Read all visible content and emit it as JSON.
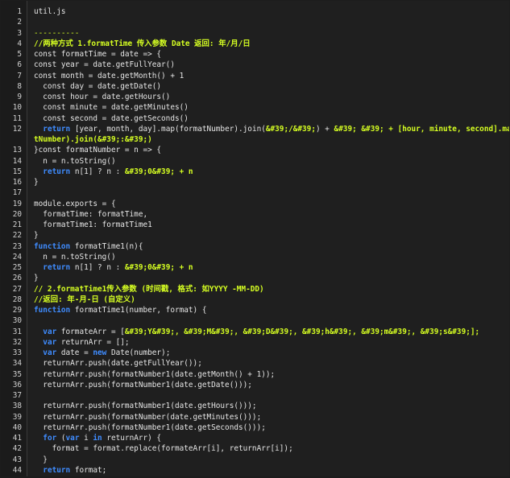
{
  "editor": {
    "lines": [
      {
        "n": null,
        "tokens": [
          {
            "t": "util.js",
            "c": "plain"
          }
        ]
      },
      {
        "n": null,
        "tokens": []
      },
      {
        "n": "3",
        "tokens": [
          {
            "t": "----------",
            "c": "dash"
          }
        ]
      },
      {
        "n": "4",
        "tokens": [
          {
            "t": "//两种方式 1.formatTime 传入参数 Date 返回: 年/月/日",
            "c": "cm"
          }
        ]
      },
      {
        "n": "5",
        "tokens": [
          {
            "t": "const formatTime = date => {",
            "c": "plain"
          }
        ]
      },
      {
        "n": "6",
        "tokens": [
          {
            "t": "const year = date.getFullYear()",
            "c": "plain"
          }
        ]
      },
      {
        "n": "7",
        "tokens": [
          {
            "t": "const month = date.getMonth() + 1",
            "c": "plain"
          }
        ]
      },
      {
        "n": "8",
        "tokens": [
          {
            "t": "  const day = date.getDate()",
            "c": "plain"
          }
        ]
      },
      {
        "n": "9",
        "tokens": [
          {
            "t": "  const hour = date.getHours()",
            "c": "plain"
          }
        ]
      },
      {
        "n": "10",
        "tokens": [
          {
            "t": "  const minute = date.getMinutes()",
            "c": "plain"
          }
        ]
      },
      {
        "n": "11",
        "tokens": [
          {
            "t": "  const second = date.getSeconds()",
            "c": "plain"
          }
        ]
      },
      {
        "n": "12",
        "tokens": [
          {
            "t": "  ",
            "c": "plain"
          },
          {
            "t": "return",
            "c": "kw"
          },
          {
            "t": " [year, month, day].map(formatNumber).join(",
            "c": "plain"
          },
          {
            "t": "&#39;/&#39;",
            "c": "str"
          },
          {
            "t": ") + ",
            "c": "plain"
          },
          {
            "t": "&#39; &#39;",
            "c": "str"
          },
          {
            "t": " + [hour, minute, second].map(forma",
            "c": "str"
          }
        ]
      },
      {
        "n": null,
        "tokens": [
          {
            "t": "tNumber).join(&#39;:&#39;)",
            "c": "str"
          }
        ]
      },
      {
        "n": "13",
        "tokens": [
          {
            "t": "}const formatNumber = n => {",
            "c": "plain"
          }
        ]
      },
      {
        "n": "14",
        "tokens": [
          {
            "t": "  n = n.toString()",
            "c": "plain"
          }
        ]
      },
      {
        "n": "15",
        "tokens": [
          {
            "t": "  ",
            "c": "plain"
          },
          {
            "t": "return",
            "c": "kw"
          },
          {
            "t": " n[1] ? n : ",
            "c": "plain"
          },
          {
            "t": "&#39;0&#39; + n",
            "c": "str"
          }
        ]
      },
      {
        "n": "16",
        "tokens": [
          {
            "t": "}",
            "c": "plain"
          }
        ]
      },
      {
        "n": "17",
        "tokens": []
      },
      {
        "n": "19",
        "tokens": [
          {
            "t": "module.exports = {",
            "c": "plain"
          }
        ]
      },
      {
        "n": "20",
        "tokens": [
          {
            "t": "  formatTime: formatTime,",
            "c": "plain"
          }
        ]
      },
      {
        "n": "21",
        "tokens": [
          {
            "t": "  formatTime1: formatTime1",
            "c": "plain"
          }
        ]
      },
      {
        "n": "22",
        "tokens": [
          {
            "t": "}",
            "c": "plain"
          }
        ]
      },
      {
        "n": "23",
        "tokens": [
          {
            "t": "function",
            "c": "kw"
          },
          {
            "t": " formatTime1(n){",
            "c": "plain"
          }
        ]
      },
      {
        "n": "24",
        "tokens": [
          {
            "t": "  n = n.toString()",
            "c": "plain"
          }
        ]
      },
      {
        "n": "25",
        "tokens": [
          {
            "t": "  ",
            "c": "plain"
          },
          {
            "t": "return",
            "c": "kw"
          },
          {
            "t": " n[1] ? n : ",
            "c": "plain"
          },
          {
            "t": "&#39;0&#39; + n",
            "c": "str"
          }
        ]
      },
      {
        "n": "26",
        "tokens": [
          {
            "t": "}",
            "c": "plain"
          }
        ]
      },
      {
        "n": "27",
        "tokens": [
          {
            "t": "// 2.formatTime1传入参数 (时间戳, 格式: 如YYYY -MM-DD)",
            "c": "cm"
          }
        ]
      },
      {
        "n": "28",
        "tokens": [
          {
            "t": "//返回: 年-月-日 (自定义)",
            "c": "cm"
          }
        ]
      },
      {
        "n": "29",
        "tokens": [
          {
            "t": "function",
            "c": "kw"
          },
          {
            "t": " formatTime1(number, format) {",
            "c": "plain"
          }
        ]
      },
      {
        "n": "30",
        "tokens": []
      },
      {
        "n": "31",
        "tokens": [
          {
            "t": "  ",
            "c": "plain"
          },
          {
            "t": "var",
            "c": "kw"
          },
          {
            "t": " formateArr = [",
            "c": "plain"
          },
          {
            "t": "&#39;Y&#39;, &#39;M&#39;, &#39;D&#39;, &#39;h&#39;, &#39;m&#39;, &#39;s&#39;];",
            "c": "str"
          }
        ]
      },
      {
        "n": "32",
        "tokens": [
          {
            "t": "  ",
            "c": "plain"
          },
          {
            "t": "var",
            "c": "kw"
          },
          {
            "t": " returnArr = [];",
            "c": "plain"
          }
        ]
      },
      {
        "n": "33",
        "tokens": [
          {
            "t": "  ",
            "c": "plain"
          },
          {
            "t": "var",
            "c": "kw"
          },
          {
            "t": " date = ",
            "c": "plain"
          },
          {
            "t": "new",
            "c": "kw"
          },
          {
            "t": " Date(number);",
            "c": "plain"
          }
        ]
      },
      {
        "n": "34",
        "tokens": [
          {
            "t": "  returnArr.push(date.getFullYear());",
            "c": "plain"
          }
        ]
      },
      {
        "n": "35",
        "tokens": [
          {
            "t": "  returnArr.push(formatNumber1(date.getMonth() + 1));",
            "c": "plain"
          }
        ]
      },
      {
        "n": "36",
        "tokens": [
          {
            "t": "  returnArr.push(formatNumber1(date.getDate()));",
            "c": "plain"
          }
        ]
      },
      {
        "n": "37",
        "tokens": []
      },
      {
        "n": "38",
        "tokens": [
          {
            "t": "  returnArr.push(formatNumber1(date.getHours()));",
            "c": "plain"
          }
        ]
      },
      {
        "n": "39",
        "tokens": [
          {
            "t": "  returnArr.push(formatNumber(date.getMinutes()));",
            "c": "plain"
          }
        ]
      },
      {
        "n": "40",
        "tokens": [
          {
            "t": "  returnArr.push(formatNumber1(date.getSeconds()));",
            "c": "plain"
          }
        ]
      },
      {
        "n": "41",
        "tokens": [
          {
            "t": "  ",
            "c": "plain"
          },
          {
            "t": "for",
            "c": "kw"
          },
          {
            "t": " (",
            "c": "plain"
          },
          {
            "t": "var",
            "c": "kw"
          },
          {
            "t": " i ",
            "c": "plain"
          },
          {
            "t": "in",
            "c": "kw"
          },
          {
            "t": " returnArr) {",
            "c": "plain"
          }
        ]
      },
      {
        "n": "42",
        "tokens": [
          {
            "t": "    format = format.replace(formateArr[i], returnArr[i]);",
            "c": "plain"
          }
        ]
      },
      {
        "n": "43",
        "tokens": [
          {
            "t": "  }",
            "c": "plain"
          }
        ]
      },
      {
        "n": "44",
        "tokens": [
          {
            "t": "  ",
            "c": "plain"
          },
          {
            "t": "return",
            "c": "kw"
          },
          {
            "t": " format;",
            "c": "plain"
          }
        ]
      },
      {
        "n": null,
        "tokens": [
          {
            "t": "}",
            "c": "plain"
          }
        ]
      }
    ]
  },
  "gutter_numbers_top": [
    "1",
    "2"
  ],
  "colors": {
    "background": "#1f1f1f",
    "keyword": "#3f8cff",
    "string_comment": "#d6ff22",
    "text": "#e6e6e6"
  }
}
